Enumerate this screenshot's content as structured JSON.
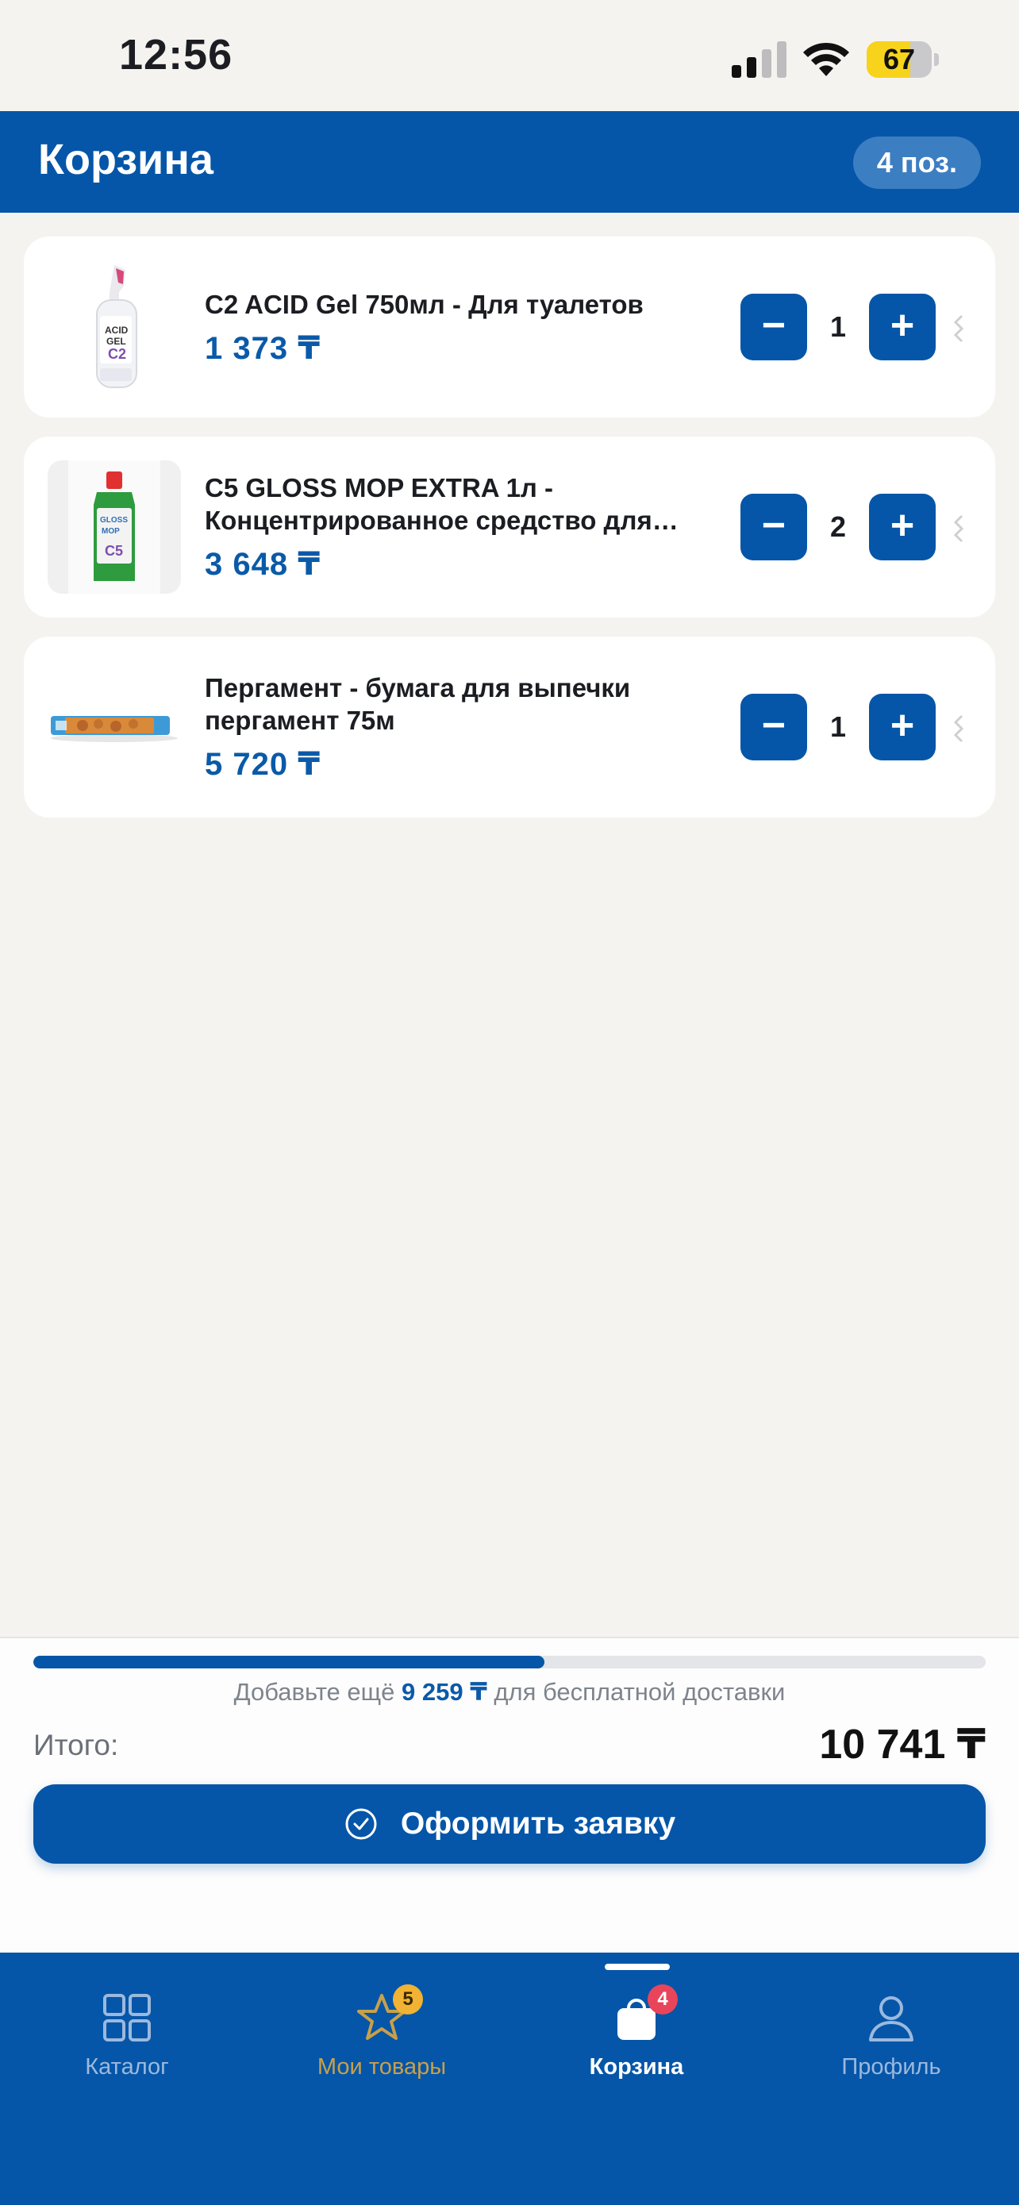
{
  "status_bar": {
    "time": "12:56",
    "battery": "67",
    "battery_level": 0.67
  },
  "header": {
    "title": "Корзина",
    "count": "4 поз."
  },
  "cart": {
    "items": [
      {
        "name": "C2 ACID Gel 750мл - Для туалетов",
        "price": "1 373 ₸",
        "qty": "1",
        "image_icon": "toilet-gel-bottle"
      },
      {
        "name": "C5 GLOSS MOP EXTRA 1л - Концентрированное средство для…",
        "price": "3 648 ₸",
        "qty": "2",
        "image_icon": "floor-cleaner-bottle"
      },
      {
        "name": "Пергамент - бумага для выпечки пергамент 75м",
        "price": "5 720 ₸",
        "qty": "1",
        "image_icon": "parchment-roll"
      }
    ]
  },
  "summary": {
    "progress": 0.537,
    "hint_prefix": "Добавьте ещё",
    "hint_amount": "9 259 ₸",
    "hint_suffix": "для бесплатной доставки",
    "total_label": "Итого:",
    "total_value": "10 741 ₸",
    "checkout_label": "Оформить заявку"
  },
  "tabbar": {
    "tabs": [
      {
        "label": "Каталог",
        "icon": "grid-icon"
      },
      {
        "label": "Мои товары",
        "icon": "star-icon",
        "badge": "5"
      },
      {
        "label": "Корзина",
        "icon": "bag-icon",
        "badge": "4",
        "active": true
      },
      {
        "label": "Профиль",
        "icon": "person-icon"
      }
    ]
  },
  "colors": {
    "primary": "#0556a8",
    "price": "#0a5aa8",
    "background": "#f5f3ef",
    "badge_red": "#e8455b",
    "badge_yellow": "#f2b233"
  }
}
